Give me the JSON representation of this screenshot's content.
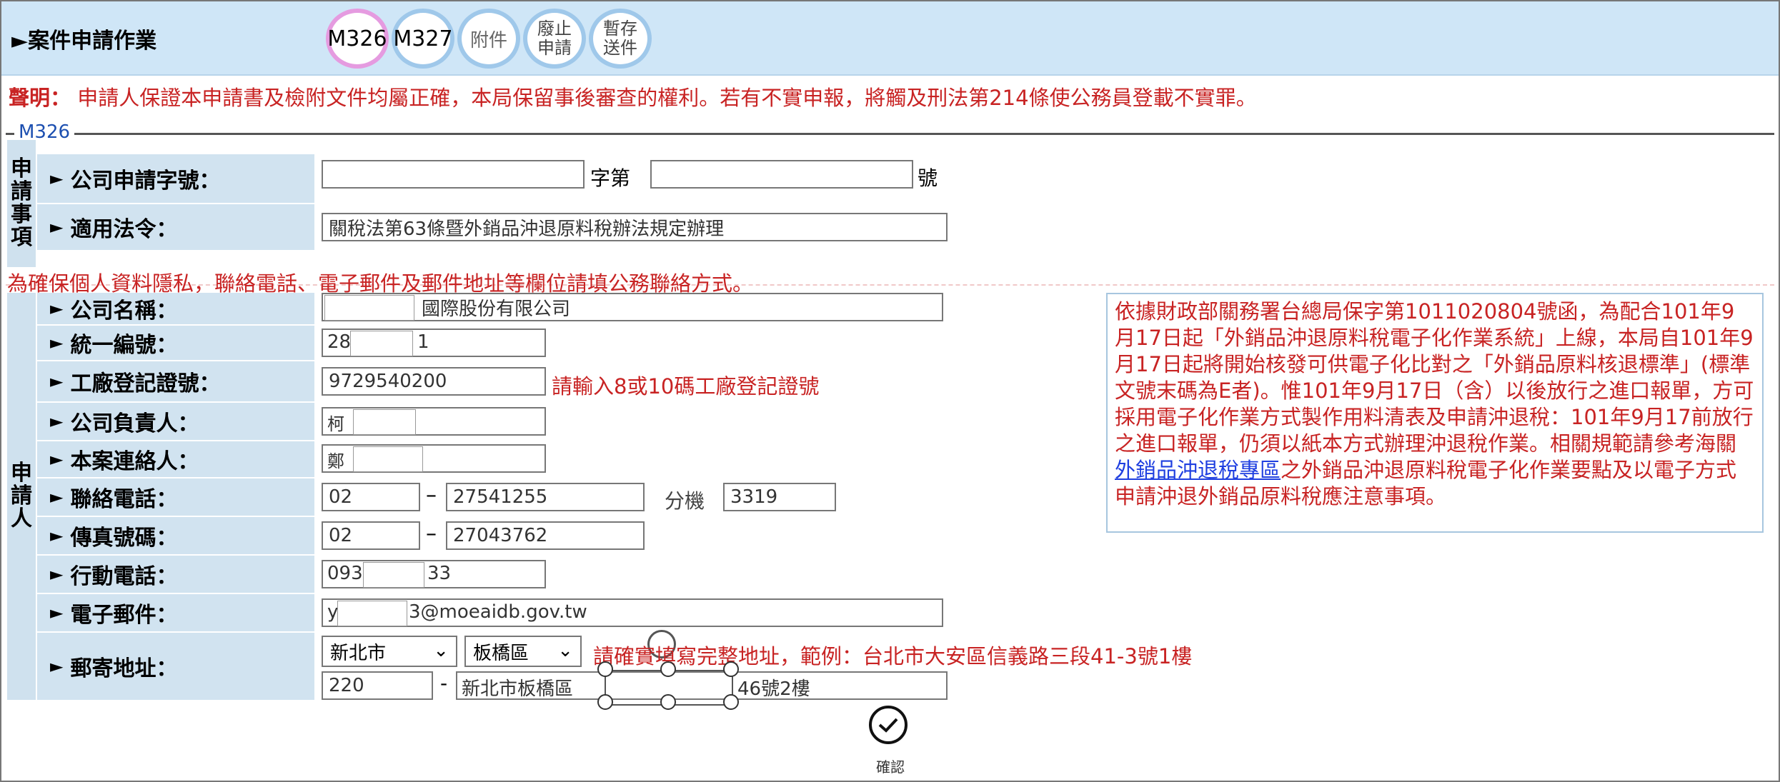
{
  "header": {
    "title": "►案件申請作業",
    "tabs": [
      {
        "label": "M326"
      },
      {
        "label": "M327"
      },
      {
        "label": "附件"
      },
      {
        "label_l1": "廢止",
        "label_l2": "申請"
      },
      {
        "label_l1": "暫存",
        "label_l2": "送件"
      }
    ]
  },
  "declaration": {
    "prefix": "聲明：",
    "text": " 申請人保證本申請書及檢附文件均屬正確，本局保留事後審查的權利。若有不實申報，將觸及刑法第214條使公務員登載不實罪。"
  },
  "fieldset": {
    "legend": "M326"
  },
  "section1": {
    "vertical_label": [
      "申",
      "請",
      "事",
      "項"
    ],
    "company_app_no": {
      "label": "公司申請字號：",
      "value1": "",
      "mid": "字第",
      "value2": "",
      "suffix": "號"
    },
    "law": {
      "label": "適用法令：",
      "value": "關稅法第63條暨外銷品沖退原料稅辦法規定辦理"
    }
  },
  "privacy_notice": "為確保個人資料隱私，聯絡電話、電子郵件及郵件地址等欄位請填公務聯絡方式。",
  "applicant": {
    "vertical_label": [
      "申",
      "請",
      "人"
    ],
    "company_name": {
      "label": "公司名稱：",
      "value": "國際股份有限公司"
    },
    "tax_id": {
      "label": "統一編號：",
      "value_start": "28",
      "value_end": "1"
    },
    "factory_reg": {
      "label": "工廠登記證號：",
      "value": "9729540200",
      "hint": "請輸入8或10碼工廠登記證號"
    },
    "representative": {
      "label": "公司負責人：",
      "value": "柯"
    },
    "contact": {
      "label": "本案連絡人：",
      "value": "鄭"
    },
    "phone": {
      "label": "聯絡電話：",
      "area": "02",
      "dash": "–",
      "number": "27541255",
      "ext_label": "分機",
      "ext": "3319"
    },
    "fax": {
      "label": "傳真號碼：",
      "area": "02",
      "dash": "–",
      "number": "27043762"
    },
    "mobile": {
      "label": "行動電話：",
      "value_start": "093",
      "value_end": "33"
    },
    "email": {
      "label": "電子郵件：",
      "value_start": "y",
      "value_end": "3@moeaidb.gov.tw"
    },
    "address": {
      "label": "郵寄地址：",
      "city": "新北市",
      "district": "板橋區",
      "hint": "請確實填寫完整地址，範例：台北市大安區信義路三段41-3號1樓",
      "zip": "220",
      "dash": "-",
      "street_start": "新北市板橋區",
      "street_end": "46號2樓"
    }
  },
  "side_note": {
    "text_before_link": "依據財政部關務署台總局保字第1011020804號函，為配合101年9月17日起「外銷品沖退原料稅電子化作業系統」上線，本局自101年9月17日起將開始核發可供電子化比對之「外銷品原料核退標準」(標準文號末碼為E者)。惟101年9月17日（含）以後放行之進口報單，方可採用電子化作業方式製作用料清表及申請沖退稅：101年9月17前放行之進口報單，仍須以紙本方式辦理沖退稅作業。相關規範請參考海關",
    "link": "外銷品沖退稅專區",
    "text_after_link": "之外銷品沖退原料稅電子化作業要點及以電子方式申請沖退外銷品原料稅應注意事項。"
  },
  "confirm": {
    "label": "確認"
  },
  "colors": {
    "header_bg": "#cfe6f7",
    "label_bg": "#d1e3f0",
    "warn": "#c82323",
    "link": "#1f3fe0"
  }
}
